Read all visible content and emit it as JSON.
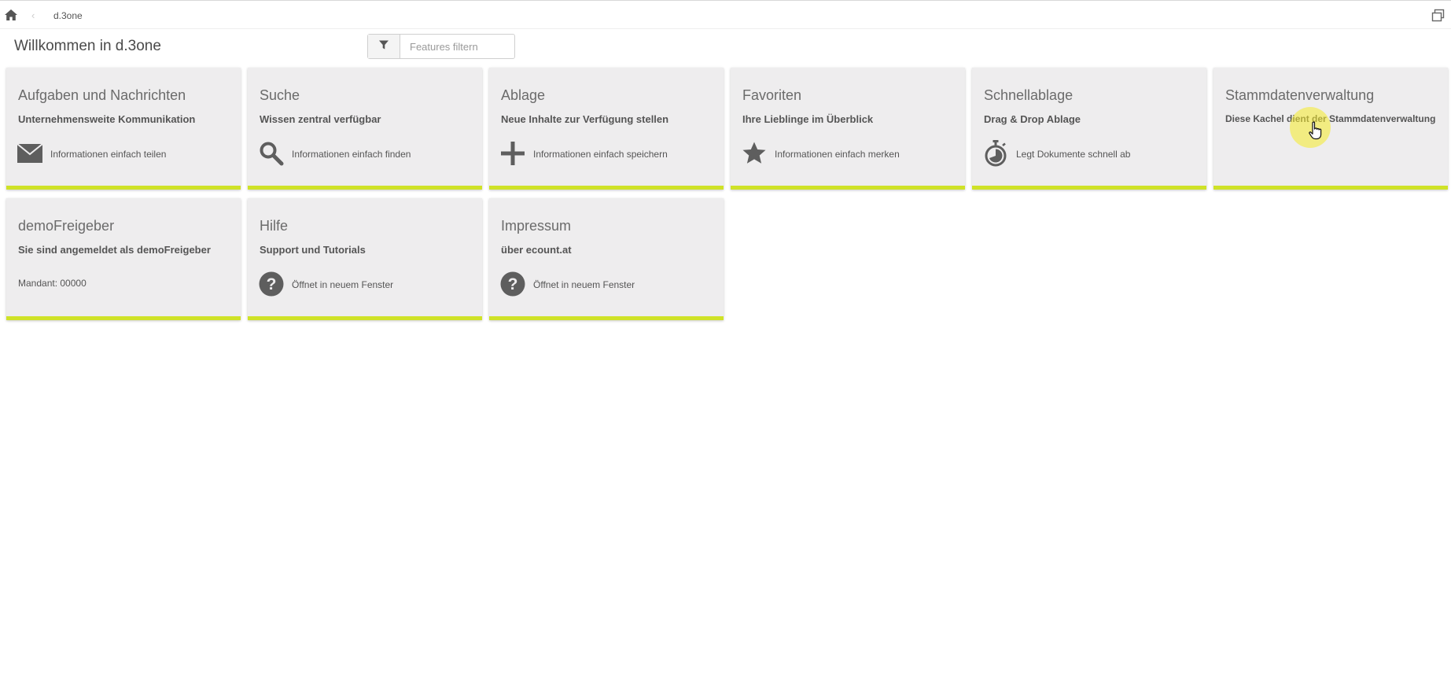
{
  "topbar": {
    "home_icon": "home-icon",
    "back_icon": "chevron-left-icon",
    "breadcrumb": "d.3one",
    "restore_icon": "window-restore-icon"
  },
  "page": {
    "title": "Willkommen in d.3one"
  },
  "filter": {
    "icon": "filter-icon",
    "placeholder": "Features filtern"
  },
  "accent_color": "#cfe227",
  "tiles": [
    {
      "title": "Aufgaben und Nachrichten",
      "subtitle": "Unternehmensweite Kommunikation",
      "icon": "envelope-icon",
      "description": "Informationen einfach teilen"
    },
    {
      "title": "Suche",
      "subtitle": "Wissen zentral verfügbar",
      "icon": "search-icon",
      "description": "Informationen einfach finden"
    },
    {
      "title": "Ablage",
      "subtitle": "Neue Inhalte zur Verfügung stellen",
      "icon": "plus-icon",
      "description": "Informationen einfach speichern"
    },
    {
      "title": "Favoriten",
      "subtitle": "Ihre Lieblinge im Überblick",
      "icon": "star-icon",
      "description": "Informationen einfach merken"
    },
    {
      "title": "Schnellablage",
      "subtitle": "Drag & Drop Ablage",
      "icon": "stopwatch-icon",
      "description": "Legt Dokumente schnell ab"
    },
    {
      "title": "Stammdatenverwaltung",
      "subtitle": "Diese Kachel dient der Stammdatenverwaltung"
    },
    {
      "title": "demoFreigeber",
      "subtitle": "Sie sind angemeldet als demoFreigeber",
      "description": "Mandant: 00000"
    },
    {
      "title": "Hilfe",
      "subtitle": "Support und Tutorials",
      "icon": "help-circle-icon",
      "description": "Öffnet in neuem Fenster"
    },
    {
      "title": "Impressum",
      "subtitle": "über ecount.at",
      "icon": "help-circle-icon",
      "description": "Öffnet in neuem Fenster"
    }
  ]
}
